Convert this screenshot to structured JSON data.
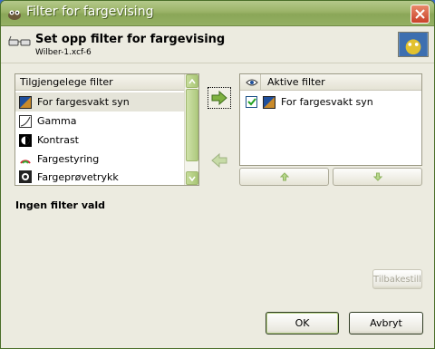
{
  "window": {
    "title": "Filter for fargevising"
  },
  "header": {
    "title": "Set opp filter for fargevising",
    "subtitle": "Wilber-1.xcf-6"
  },
  "available": {
    "header": "Tilgjengelege filter",
    "items": [
      {
        "label": "For fargesvakt syn",
        "icon": "color-deficient-icon",
        "selected": true
      },
      {
        "label": "Gamma",
        "icon": "gamma-icon",
        "selected": false
      },
      {
        "label": "Kontrast",
        "icon": "contrast-icon",
        "selected": false
      },
      {
        "label": "Fargestyring",
        "icon": "color-management-icon",
        "selected": false
      },
      {
        "label": "Fargeprøvetrykk",
        "icon": "proof-icon",
        "selected": false
      }
    ]
  },
  "active": {
    "header": "Aktive filter",
    "items": [
      {
        "label": "For fargesvakt syn",
        "checked": true,
        "icon": "color-deficient-icon"
      }
    ]
  },
  "status": {
    "text": "Ingen filter vald"
  },
  "buttons": {
    "reset": "Tilbakestill",
    "ok": "OK",
    "cancel": "Avbryt"
  },
  "colors": {
    "titlebar": "#9ab367",
    "accent_green": "#7fb241",
    "window_bg": "#ecebe0"
  }
}
